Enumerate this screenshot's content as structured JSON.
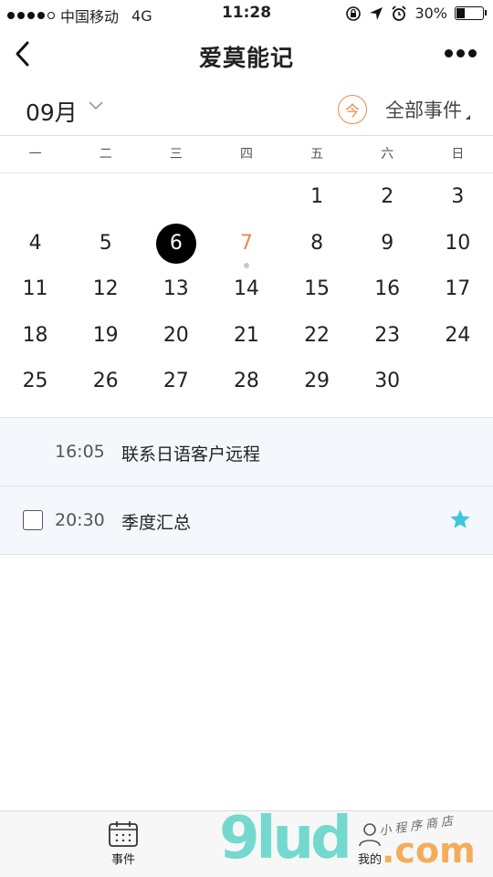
{
  "status": {
    "carrier": "中国移动",
    "network": "4G",
    "time": "11:28",
    "battery": "30%"
  },
  "nav": {
    "title": "爱莫能记"
  },
  "toolbar": {
    "month": "09月",
    "today_label": "今",
    "filter_label": "全部事件"
  },
  "calendar": {
    "weekdays": [
      "一",
      "二",
      "三",
      "四",
      "五",
      "六",
      "日"
    ],
    "weeks": [
      [
        "",
        "",
        "",
        "",
        "1",
        "2",
        "3"
      ],
      [
        "4",
        "5",
        "6",
        "7",
        "8",
        "9",
        "10"
      ],
      [
        "11",
        "12",
        "13",
        "14",
        "15",
        "16",
        "17"
      ],
      [
        "18",
        "19",
        "20",
        "21",
        "22",
        "23",
        "24"
      ],
      [
        "25",
        "26",
        "27",
        "28",
        "29",
        "30",
        ""
      ]
    ],
    "selected_day": "6",
    "today_day": "7"
  },
  "events": [
    {
      "time": "16:05",
      "title": "联系日语客户远程",
      "has_checkbox": false,
      "starred": false
    },
    {
      "time": "20:30",
      "title": "季度汇总",
      "has_checkbox": true,
      "starred": true
    }
  ],
  "tabbar": {
    "events_label": "事件",
    "mine_label": "我的"
  },
  "watermark": {
    "main": "9lud",
    "suffix": ".com",
    "tagline": "小程序商店"
  },
  "colors": {
    "accent": "#f0884a",
    "star": "#3cc8dc",
    "event_bg": "#f4f7fb"
  }
}
